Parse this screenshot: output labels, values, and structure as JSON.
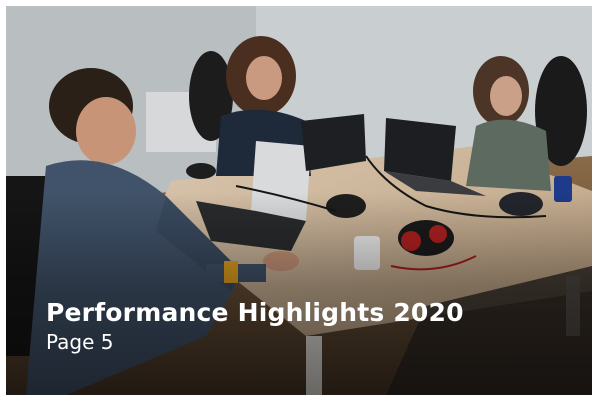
{
  "slide": {
    "title": "Performance Highlights 2020",
    "subtitle": "Page 5"
  }
}
